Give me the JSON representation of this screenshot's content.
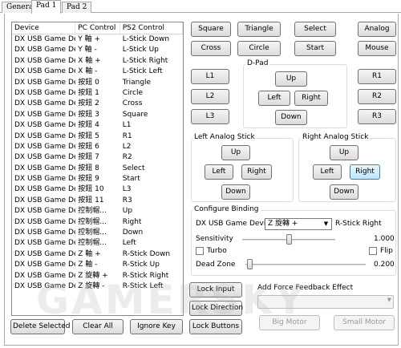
{
  "tabs": [
    "General",
    "Pad 1",
    "Pad 2"
  ],
  "list": {
    "headers": [
      "Device",
      "PC Control",
      "PS2 Control"
    ],
    "rows": [
      [
        "DX USB Game De...",
        "Y 軸 +",
        "L-Stick Down"
      ],
      [
        "DX USB Game De...",
        "Y 軸 -",
        "L-Stick Up"
      ],
      [
        "DX USB Game De...",
        "X 軸 +",
        "L-Stick Right"
      ],
      [
        "DX USB Game De...",
        "X 軸 -",
        "L-Stick Left"
      ],
      [
        "DX USB Game De...",
        "按鈕 0",
        "Triangle"
      ],
      [
        "DX USB Game De...",
        "按鈕 1",
        "Circle"
      ],
      [
        "DX USB Game De...",
        "按鈕 2",
        "Cross"
      ],
      [
        "DX USB Game De...",
        "按鈕 3",
        "Square"
      ],
      [
        "DX USB Game De...",
        "按鈕 4",
        "L1"
      ],
      [
        "DX USB Game De...",
        "按鈕 5",
        "R1"
      ],
      [
        "DX USB Game De...",
        "按鈕 6",
        "L2"
      ],
      [
        "DX USB Game De...",
        "按鈕 7",
        "R2"
      ],
      [
        "DX USB Game De...",
        "按鈕 8",
        "Select"
      ],
      [
        "DX USB Game De...",
        "按鈕 9",
        "Start"
      ],
      [
        "DX USB Game De...",
        "按鈕 10",
        "L3"
      ],
      [
        "DX USB Game De...",
        "按鈕 11",
        "R3"
      ],
      [
        "DX USB Game De...",
        "控制帽...",
        "Up"
      ],
      [
        "DX USB Game De...",
        "控制帽...",
        "Right"
      ],
      [
        "DX USB Game De...",
        "控制帽...",
        "Down"
      ],
      [
        "DX USB Game De...",
        "控制帽...",
        "Left"
      ],
      [
        "DX USB Game De...",
        "Z 軸 +",
        "R-Stick Down"
      ],
      [
        "DX USB Game De...",
        "Z 軸 -",
        "R-Stick Up"
      ],
      [
        "DX USB Game De...",
        "Z 旋轉 +",
        "R-Stick Right"
      ],
      [
        "DX USB Game De...",
        "Z 旋轉 -",
        "R-Stick Left"
      ]
    ]
  },
  "bottom_buttons": {
    "delete_selected": "Delete Selected",
    "clear_all": "Clear All",
    "ignore_key": "Ignore Key",
    "lock_buttons": "Lock Buttons",
    "lock_input": "Lock Input",
    "lock_direction": "Lock Direction"
  },
  "face_buttons": {
    "square": "Square",
    "triangle": "Triangle",
    "select": "Select",
    "analog": "Analog",
    "cross": "Cross",
    "circle": "Circle",
    "start": "Start",
    "mouse": "Mouse"
  },
  "shoulders": {
    "l1": "L1",
    "l2": "L2",
    "l3": "L3",
    "r1": "R1",
    "r2": "R2",
    "r3": "R3"
  },
  "dpad": {
    "title": "D-Pad",
    "up": "Up",
    "left": "Left",
    "right": "Right",
    "down": "Down"
  },
  "left_stick": {
    "title": "Left Analog Stick",
    "up": "Up",
    "left": "Left",
    "right": "Right",
    "down": "Down"
  },
  "right_stick": {
    "title": "Right Analog Stick",
    "up": "Up",
    "left": "Left",
    "right": "Right",
    "down": "Down"
  },
  "binding": {
    "title": "Configure Binding",
    "device": "DX USB Game Device",
    "control": "Z 旋轉 +",
    "target": "R-Stick Right",
    "sensitivity_label": "Sensitivity",
    "sensitivity_value": "1.000",
    "sensitivity_fraction": 0.5,
    "turbo_label": "Turbo",
    "flip_label": "Flip",
    "dead_zone_label": "Dead Zone",
    "dead_zone_value": "0.200",
    "dead_zone_fraction": 0.03
  },
  "force_feedback": {
    "title": "Add Force Feedback Effect",
    "big_motor": "Big Motor",
    "small_motor": "Small Motor"
  },
  "watermark": "GAMERSKY"
}
